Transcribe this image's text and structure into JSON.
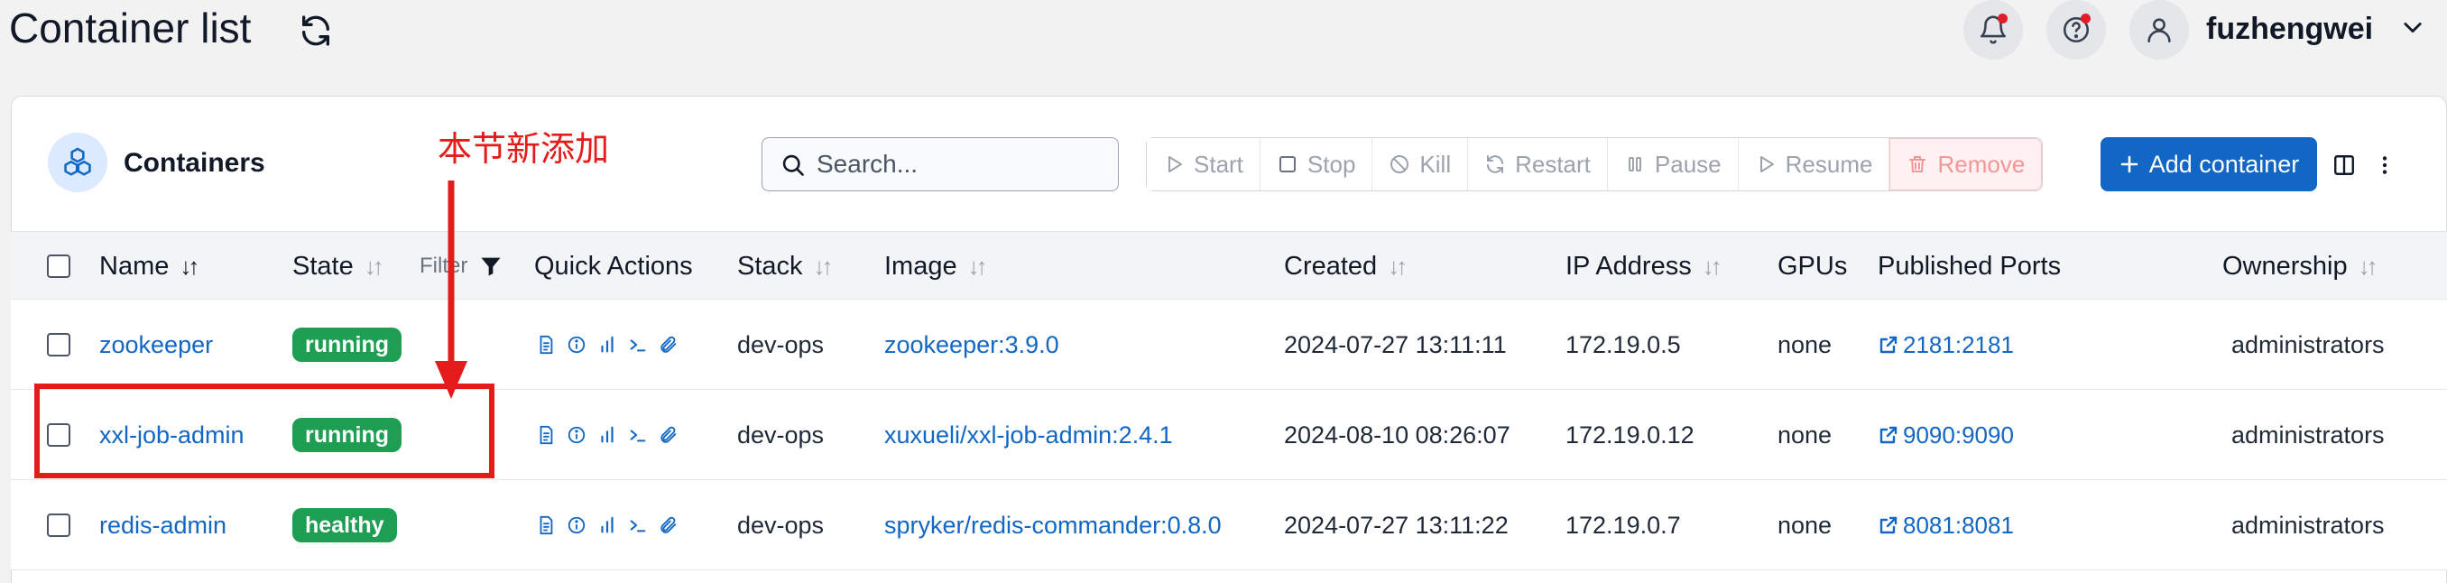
{
  "header": {
    "title": "Container list",
    "username": "fuzhengwei",
    "icons": [
      "refresh-icon",
      "bell-icon",
      "help-icon",
      "user-icon",
      "chevron-down-icon"
    ]
  },
  "card": {
    "title": "Containers",
    "annotation": "本节新添加",
    "search_placeholder": "Search...",
    "actions": {
      "start": "Start",
      "stop": "Stop",
      "kill": "Kill",
      "restart": "Restart",
      "pause": "Pause",
      "resume": "Resume",
      "remove": "Remove"
    },
    "add_label": "Add container"
  },
  "table": {
    "headers": {
      "name": "Name",
      "state": "State",
      "filter": "Filter",
      "quick_actions": "Quick Actions",
      "stack": "Stack",
      "image": "Image",
      "created": "Created",
      "ip": "IP Address",
      "gpus": "GPUs",
      "ports": "Published Ports",
      "ownership": "Ownership"
    },
    "rows": [
      {
        "name": "zookeeper",
        "state": "running",
        "stack": "dev-ops",
        "image": "zookeeper:3.9.0",
        "created": "2024-07-27 13:11:11",
        "ip": "172.19.0.5",
        "gpus": "none",
        "ports": "2181:2181",
        "ownership": "administrators"
      },
      {
        "name": "xxl-job-admin",
        "state": "running",
        "stack": "dev-ops",
        "image": "xuxueli/xxl-job-admin:2.4.1",
        "created": "2024-08-10 08:26:07",
        "ip": "172.19.0.12",
        "gpus": "none",
        "ports": "9090:9090",
        "ownership": "administrators"
      },
      {
        "name": "redis-admin",
        "state": "healthy",
        "stack": "dev-ops",
        "image": "spryker/redis-commander:0.8.0",
        "created": "2024-07-27 13:11:22",
        "ip": "172.19.0.7",
        "gpus": "none",
        "ports": "8081:8081",
        "ownership": "administrators"
      }
    ]
  },
  "colors": {
    "primary": "#1167c3",
    "status_green": "#1e9e52",
    "annotation_red": "#e31b1b",
    "notification_dot": "#e11d2a"
  }
}
